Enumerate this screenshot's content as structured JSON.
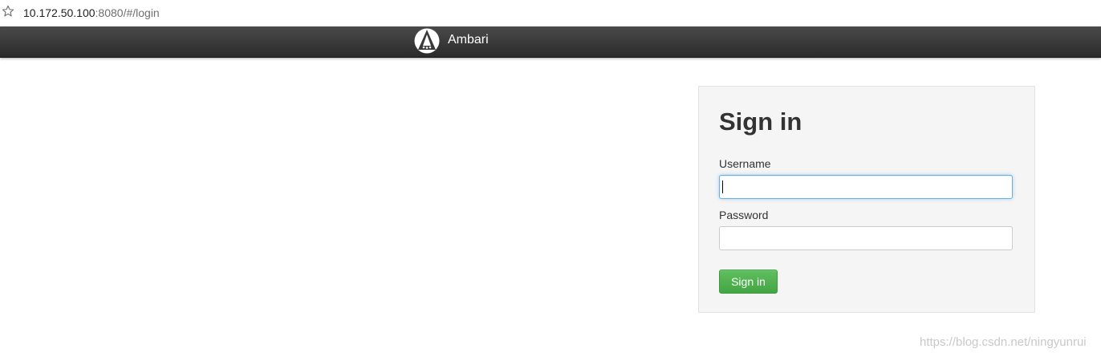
{
  "browser": {
    "url_host": "10.172.50.100",
    "url_rest": ":8080/#/login"
  },
  "navbar": {
    "brand_name": "Ambari"
  },
  "login": {
    "title": "Sign in",
    "username_label": "Username",
    "username_value": "",
    "password_label": "Password",
    "password_value": "",
    "submit_label": "Sign in"
  },
  "watermark": "https://blog.csdn.net/ningyunrui",
  "colors": {
    "navbar": "#333333",
    "panel_bg": "#f5f5f5",
    "button_green": "#4cae4c",
    "focus_blue": "#66afe9"
  },
  "icons": {
    "bookmark": "star-icon",
    "brand": "ambari-logo-icon"
  }
}
